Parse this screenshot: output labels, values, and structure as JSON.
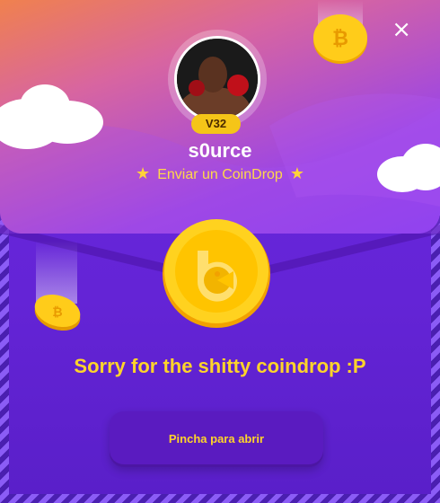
{
  "dialog": {
    "close_label": "×",
    "level_badge": "V32",
    "username": "s0urce",
    "subtitle": "Enviar un CoinDrop",
    "message": "Sorry for the shitty coindrop :P",
    "open_button": "Pincha para abrir"
  },
  "colors": {
    "accent_yellow": "#ffd42a",
    "purple_bg": "#6424d6",
    "flap_orange": "#f0814e",
    "flap_purple": "#8a3ef0",
    "button_bg": "#5a1bc0"
  },
  "icons": [
    "close-icon",
    "star-icon",
    "bitcoin-coin-icon",
    "coin-logo-icon",
    "cloud-icon"
  ]
}
